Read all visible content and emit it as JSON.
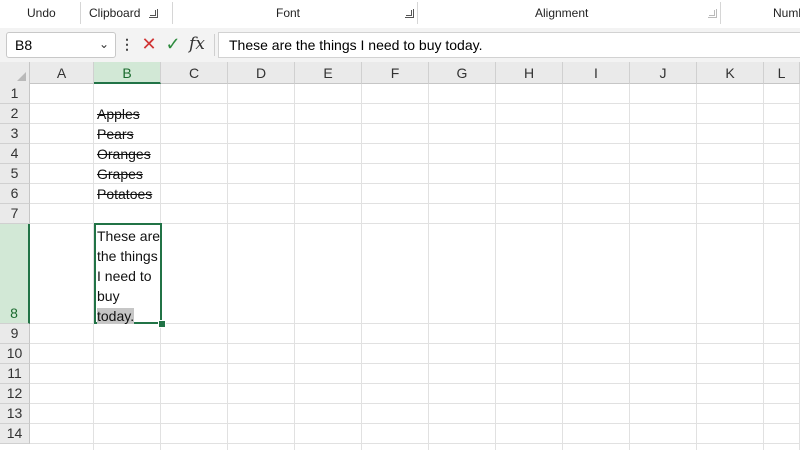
{
  "ribbon": {
    "groups": [
      "Undo",
      "Clipboard",
      "Font",
      "Alignment",
      "Numb"
    ]
  },
  "formula_bar": {
    "name_box": "B8",
    "formula": "These are the things I need to buy today."
  },
  "sheet": {
    "columns": [
      "A",
      "B",
      "C",
      "D",
      "E",
      "F",
      "G",
      "H",
      "I",
      "J",
      "K",
      "L"
    ],
    "rows": [
      "1",
      "2",
      "3",
      "4",
      "5",
      "6",
      "7",
      "8",
      "9",
      "10",
      "11",
      "12",
      "13",
      "14"
    ],
    "selected_column": "B",
    "selected_row": "8",
    "cells": {
      "B2": "Apples",
      "B3": "Pears",
      "B4": "Oranges",
      "B5": "Grapes",
      "B6": "Potatoes"
    },
    "b8_lines": [
      "These are",
      "the things",
      "I need to",
      "buy"
    ],
    "b8_last": "today."
  },
  "colors": {
    "accent": "#217346",
    "selection_header": "#d2e8d6",
    "cancel": "#d03434",
    "enter": "#2e8b3e"
  }
}
